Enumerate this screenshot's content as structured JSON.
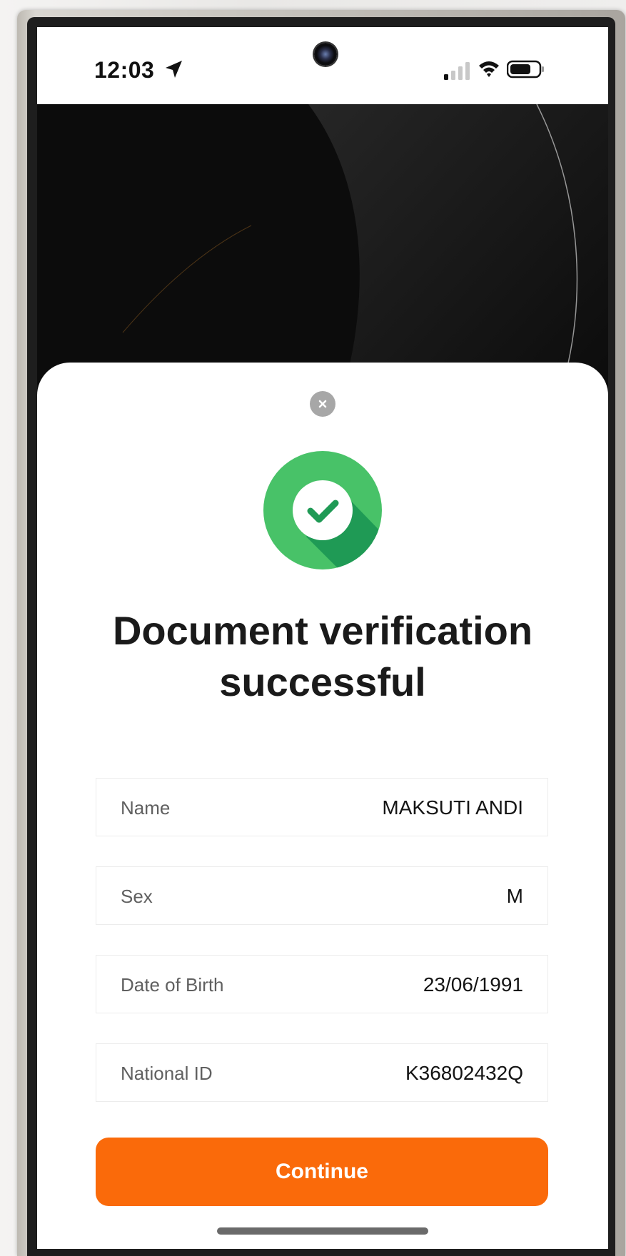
{
  "status_bar": {
    "time": "12:03",
    "icons": [
      "location-arrow-icon",
      "front-camera-icon",
      "cellular-signal-icon",
      "wifi-icon",
      "battery-icon"
    ]
  },
  "sheet": {
    "close_icon": "close-icon",
    "success_icon": "check-circle-icon",
    "title": "Document verification successful",
    "fields": [
      {
        "label": "Name",
        "value": "MAKSUTI ANDI"
      },
      {
        "label": "Sex",
        "value": "M"
      },
      {
        "label": "Date of Birth",
        "value": "23/06/1991"
      },
      {
        "label": "National ID",
        "value": "K36802432Q"
      }
    ],
    "continue_label": "Continue"
  },
  "colors": {
    "accent": "#fa6a0a",
    "success_light": "#48c268",
    "success_dark": "#1f9a55",
    "text": "#1a1a1a",
    "muted": "#606060"
  }
}
